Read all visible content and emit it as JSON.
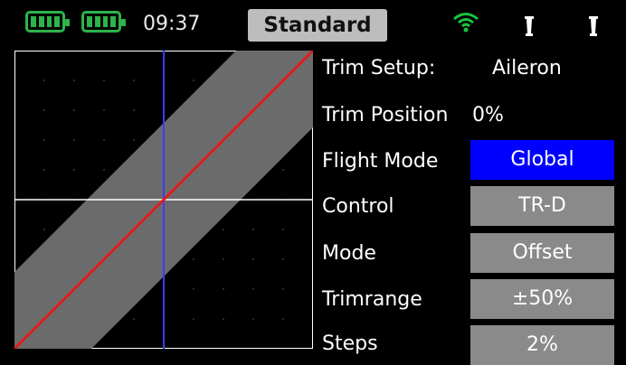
{
  "status": {
    "batteries": [
      {
        "name": "tx-battery",
        "level": 1.0
      },
      {
        "name": "rx-battery",
        "level": 1.0
      }
    ],
    "time": "09:37",
    "model_name": "Standard",
    "colors": {
      "battery": "#2db44a",
      "wifi": "#19c33b",
      "selected": "#0000ff",
      "button": "#8a8a8a"
    }
  },
  "graph": {
    "curve_color": "#e01e1e",
    "band_color": "#6b6b6b",
    "axis_v_color": "#3b3bff",
    "axis_h_color": "#ffffff"
  },
  "setup": {
    "trim_setup_label": "Trim Setup:",
    "trim_setup_value": "Aileron",
    "trim_position_label": "Trim Position",
    "trim_position_value": "0%",
    "rows": [
      {
        "label": "Flight Mode",
        "value": "Global"
      },
      {
        "label": "Control",
        "value": "TR-D"
      },
      {
        "label": "Mode",
        "value": "Offset"
      },
      {
        "label": "Trimrange",
        "value": "±50%"
      },
      {
        "label": "Steps",
        "value": "2%"
      }
    ]
  }
}
